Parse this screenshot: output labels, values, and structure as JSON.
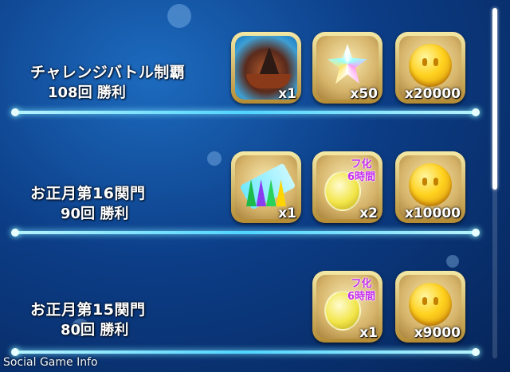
{
  "rows": [
    {
      "title": "チャレンジバトル制覇",
      "count": "108回 勝利",
      "rewards": [
        {
          "icon": "pirate-ship-icon",
          "qty": "x1"
        },
        {
          "icon": "crystal-icon",
          "qty": "x50"
        },
        {
          "icon": "gold-coin-icon",
          "qty": "x20000"
        }
      ]
    },
    {
      "title": "お正月第16関門",
      "count": "90回 勝利",
      "rewards": [
        {
          "icon": "ticket-icon",
          "qty": "x1"
        },
        {
          "icon": "potion-icon",
          "qty": "x2",
          "tag_line1": "フ化",
          "tag_line2": "6時間"
        },
        {
          "icon": "gold-coin-icon",
          "qty": "x10000"
        }
      ]
    },
    {
      "title": "お正月第15関門",
      "count": "80回 勝利",
      "rewards": [
        {
          "icon": "potion-icon",
          "qty": "x1",
          "tag_line1": "フ化",
          "tag_line2": "6時間"
        },
        {
          "icon": "gold-coin-icon",
          "qty": "x9000"
        }
      ]
    }
  ],
  "watermark": "Social Game Info",
  "colors": {
    "background": "#0c3d86",
    "divider": "#4fd5ff",
    "frame_gold": "#d6b46a",
    "tag_purple": "#c52ff0"
  }
}
